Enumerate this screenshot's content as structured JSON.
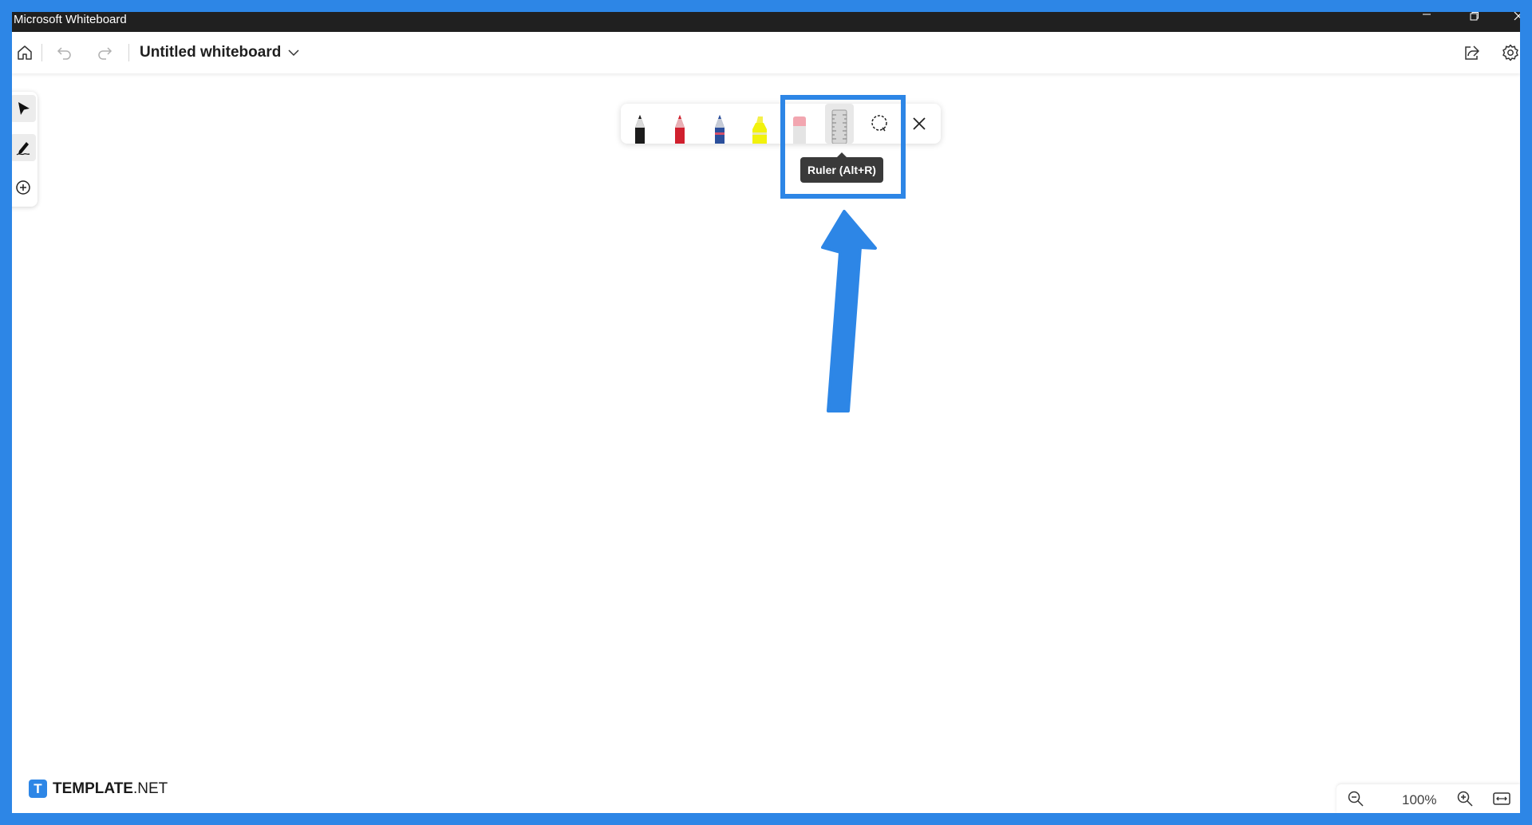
{
  "window": {
    "title": "Microsoft Whiteboard",
    "controls": [
      "minimize",
      "restore",
      "close"
    ]
  },
  "header": {
    "board_title": "Untitled whiteboard",
    "icons": [
      "home-icon",
      "undo-icon",
      "redo-icon",
      "chevron-down-icon",
      "share-icon",
      "gear-icon"
    ]
  },
  "left_toolbar": {
    "items": [
      {
        "name": "select",
        "icon": "cursor-icon",
        "active": true
      },
      {
        "name": "inking",
        "icon": "pen-icon",
        "active": true
      },
      {
        "name": "create",
        "icon": "plus-circle-icon",
        "active": false
      }
    ]
  },
  "pen_tray": {
    "pens": [
      {
        "name": "black-pen",
        "color": "#1c1c1c"
      },
      {
        "name": "red-pen",
        "color": "#d0202e"
      },
      {
        "name": "blue-pen",
        "color": "#2b4f9c"
      },
      {
        "name": "highlighter",
        "color": "#f2f20c"
      }
    ],
    "tools": [
      "eraser-icon",
      "ruler-icon",
      "lasso-icon",
      "close-icon"
    ],
    "tooltip": "Ruler (Alt+R)"
  },
  "annotation": {
    "highlight_color": "#2d86e6",
    "arrow_color": "#2d86e6"
  },
  "zoom": {
    "value": "100%",
    "icons": [
      "zoom-out-icon",
      "zoom-in-icon",
      "fit-to-screen-icon"
    ]
  },
  "watermark": {
    "logo_letter": "T",
    "brand_bold": "TEMPLATE",
    "brand_suffix": ".NET"
  }
}
